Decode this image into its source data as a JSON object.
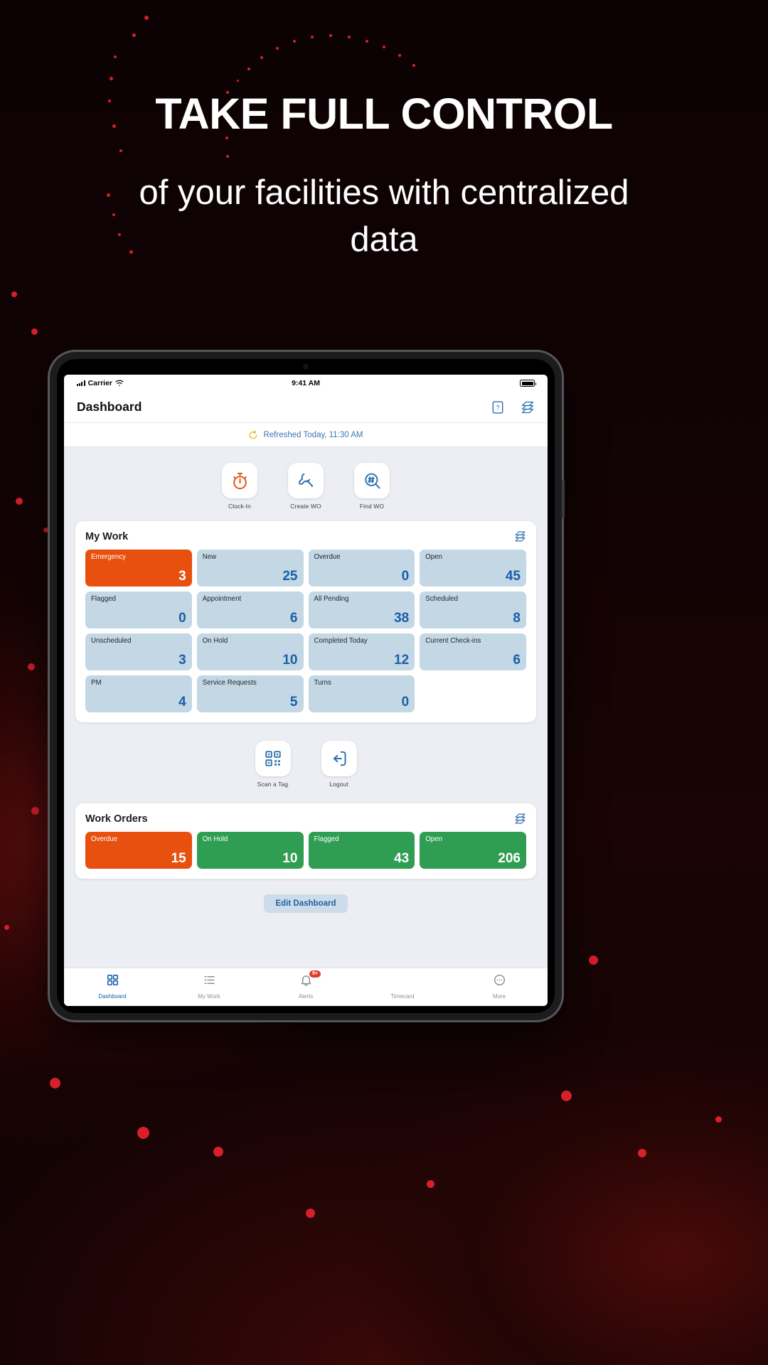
{
  "promo": {
    "headline": "TAKE FULL CONTROL",
    "subheadline": "of your facilities with centralized data",
    "accent_color": "#d6202a",
    "background_color": "#0a0203"
  },
  "device": {
    "status_bar": {
      "carrier": "Carrier",
      "time": "9:41 AM",
      "signal_icon": "cellular-signal-icon",
      "wifi_icon": "wifi-icon",
      "battery_icon": "battery-icon"
    }
  },
  "header": {
    "title": "Dashboard",
    "help_icon": "help-book-icon",
    "settings_icon": "dashboard-settings-icon"
  },
  "refresh": {
    "icon": "refresh-circular-icon",
    "text": "Refreshed Today, 11:30 AM",
    "text_color": "#3b77b5",
    "icon_color": "#f0b429"
  },
  "quick_actions": [
    {
      "label": "Clock-In",
      "icon": "stopwatch-icon",
      "color": "#e8500f"
    },
    {
      "label": "Create WO",
      "icon": "wrench-icon",
      "color": "#2e6fae"
    },
    {
      "label": "Find WO",
      "icon": "hash-search-icon",
      "color": "#2e6fae"
    }
  ],
  "my_work": {
    "title": "My Work",
    "settings_icon": "dashboard-settings-icon",
    "tiles": [
      {
        "label": "Emergency",
        "value": "3",
        "style": "accent-orange"
      },
      {
        "label": "New",
        "value": "25",
        "style": ""
      },
      {
        "label": "Overdue",
        "value": "0",
        "style": ""
      },
      {
        "label": "Open",
        "value": "45",
        "style": ""
      },
      {
        "label": "Flagged",
        "value": "0",
        "style": ""
      },
      {
        "label": "Appointment",
        "value": "6",
        "style": ""
      },
      {
        "label": "All Pending",
        "value": "38",
        "style": ""
      },
      {
        "label": "Scheduled",
        "value": "8",
        "style": ""
      },
      {
        "label": "Unscheduled",
        "value": "3",
        "style": ""
      },
      {
        "label": "On Hold",
        "value": "10",
        "style": ""
      },
      {
        "label": "Completed Today",
        "value": "12",
        "style": ""
      },
      {
        "label": "Current Check-ins",
        "value": "6",
        "style": ""
      },
      {
        "label": "PM",
        "value": "4",
        "style": ""
      },
      {
        "label": "Service Requests",
        "value": "5",
        "style": ""
      },
      {
        "label": "Turns",
        "value": "0",
        "style": ""
      }
    ]
  },
  "mid_actions": [
    {
      "label": "Scan a Tag",
      "icon": "qr-code-icon",
      "color": "#2e6fae"
    },
    {
      "label": "Logout",
      "icon": "logout-icon",
      "color": "#2e6fae"
    }
  ],
  "work_orders": {
    "title": "Work Orders",
    "settings_icon": "dashboard-settings-icon",
    "tiles": [
      {
        "label": "Overdue",
        "value": "15",
        "style": "accent-orange"
      },
      {
        "label": "On Hold",
        "value": "10",
        "style": "accent-green"
      },
      {
        "label": "Flagged",
        "value": "43",
        "style": "accent-green"
      },
      {
        "label": "Open",
        "value": "206",
        "style": "accent-green"
      }
    ]
  },
  "edit_dashboard": {
    "label": "Edit Dashboard"
  },
  "tab_bar": [
    {
      "label": "Dashboard",
      "icon": "grid-icon",
      "active": true,
      "badge": ""
    },
    {
      "label": "My Work",
      "icon": "list-icon",
      "active": false,
      "badge": ""
    },
    {
      "label": "Alerts",
      "icon": "bell-icon",
      "active": false,
      "badge": "9+"
    },
    {
      "label": "Timecard",
      "icon": "stopwatch-icon",
      "active": false,
      "badge": ""
    },
    {
      "label": "More",
      "icon": "ellipsis-icon",
      "active": false,
      "badge": ""
    }
  ]
}
